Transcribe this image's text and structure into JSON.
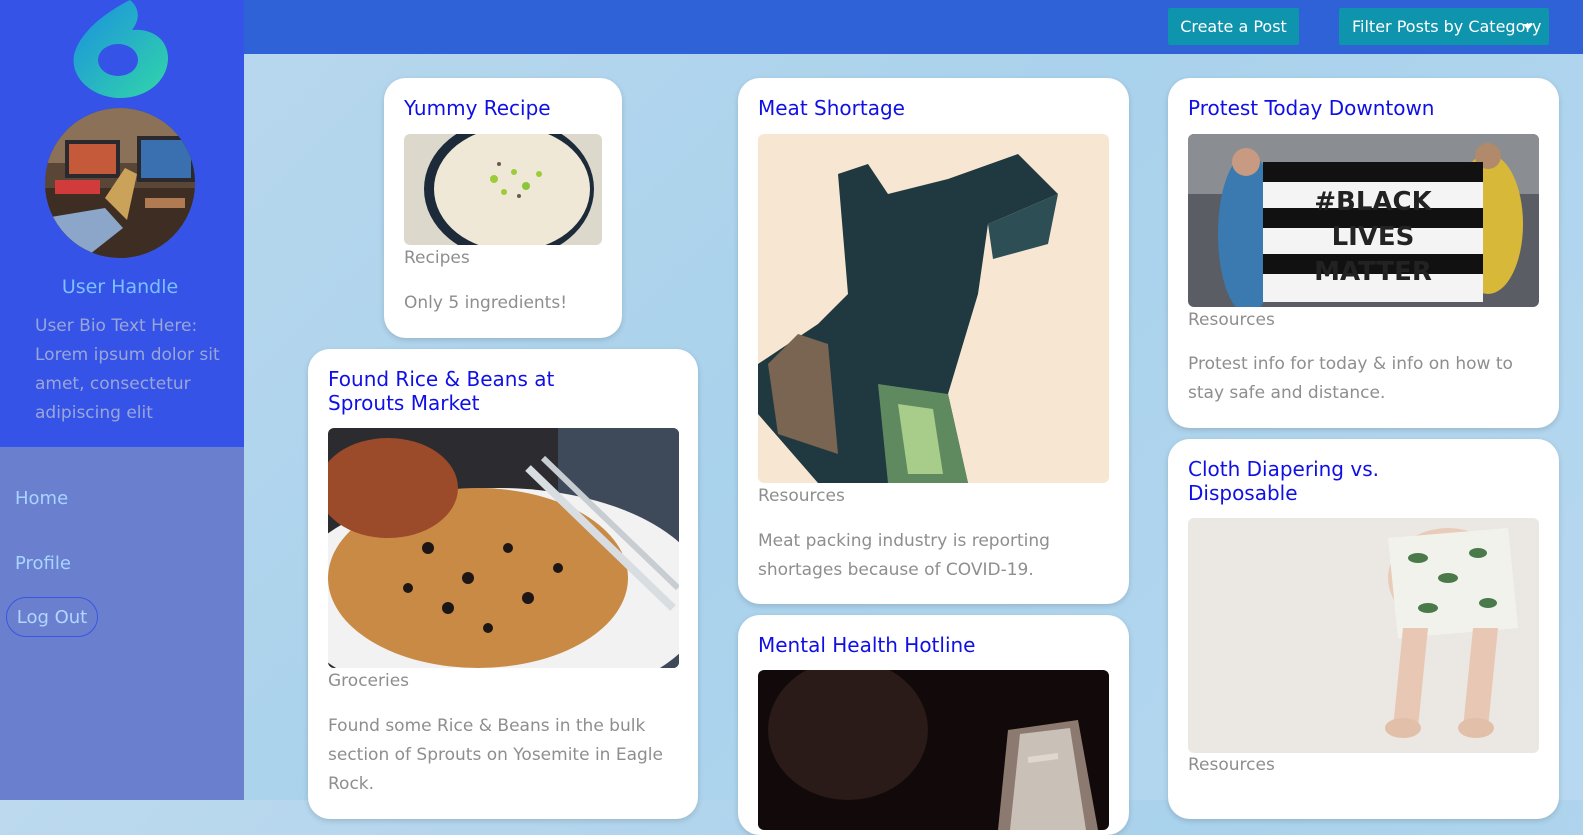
{
  "user": {
    "handle": "User Handle",
    "bio": "User Bio Text Here: Lorem ipsum dolor sit amet, consectetur adipiscing elit"
  },
  "nav": {
    "home": "Home",
    "profile": "Profile",
    "logout": "Log Out"
  },
  "toolbar": {
    "create_label": "Create a Post",
    "filter_label": "Filter Posts by Category"
  },
  "posts": [
    {
      "title": "Yummy Recipe",
      "category": "Recipes",
      "description": "Only 5 ingredients!"
    },
    {
      "title": "Found Rice & Beans at Sprouts Market",
      "category": "Groceries",
      "description": "Found some Rice & Beans in the bulk section of Sprouts on Yosemite in Eagle Rock."
    },
    {
      "title": "Meat Shortage",
      "category": "Resources",
      "description": "Meat packing industry is reporting shortages because of COVID-19."
    },
    {
      "title": "Mental Health Hotline",
      "category": "",
      "description": ""
    },
    {
      "title": "Protest Today Downtown",
      "category": "Resources",
      "description": "Protest info for today & info on how to stay safe and distance.",
      "image_text": [
        "#BLACK",
        "LIVES",
        "MATTER"
      ]
    },
    {
      "title": "Cloth Diapering vs. Disposable",
      "category": "Resources",
      "description": ""
    }
  ],
  "colors": {
    "sidebar_top": "#3553e6",
    "sidebar_bottom": "#6a80cf",
    "topbar": "#2f62d6",
    "button": "#0e94ad",
    "title": "#1010e6"
  }
}
